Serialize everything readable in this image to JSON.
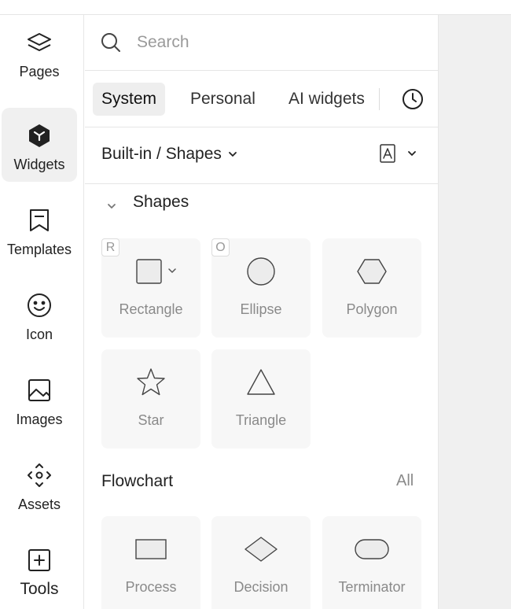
{
  "rail": {
    "items": [
      {
        "label": "Pages",
        "icon": "layers-icon"
      },
      {
        "label": "Widgets",
        "icon": "widgets-cube-icon"
      },
      {
        "label": "Templates",
        "icon": "bookmark-icon"
      },
      {
        "label": "Icon",
        "icon": "smiley-icon"
      },
      {
        "label": "Images",
        "icon": "image-icon"
      },
      {
        "label": "Assets",
        "icon": "assets-icon"
      },
      {
        "label": "Tools",
        "icon": "plus-square-icon"
      }
    ]
  },
  "search": {
    "placeholder": "Search",
    "value": ""
  },
  "tabs": [
    {
      "label": "System"
    },
    {
      "label": "Personal"
    },
    {
      "label": "AI widgets"
    }
  ],
  "breadcrumb": {
    "label": "Built-in / Shapes"
  },
  "shapes": {
    "title": "Shapes",
    "items": [
      {
        "label": "Rectangle",
        "key": "R"
      },
      {
        "label": "Ellipse",
        "key": "O"
      },
      {
        "label": "Polygon",
        "key": ""
      },
      {
        "label": "Star",
        "key": ""
      },
      {
        "label": "Triangle",
        "key": ""
      }
    ]
  },
  "flowchart": {
    "title": "Flowchart",
    "all_label": "All",
    "items": [
      {
        "label": "Process"
      },
      {
        "label": "Decision"
      },
      {
        "label": "Terminator"
      }
    ]
  },
  "colors": {
    "accent_dark": "#2b2b2b",
    "rail_active_bg": "#f0f0f0",
    "card_bg": "#f7f7f7",
    "canvas_bg": "#f0f0f0"
  }
}
